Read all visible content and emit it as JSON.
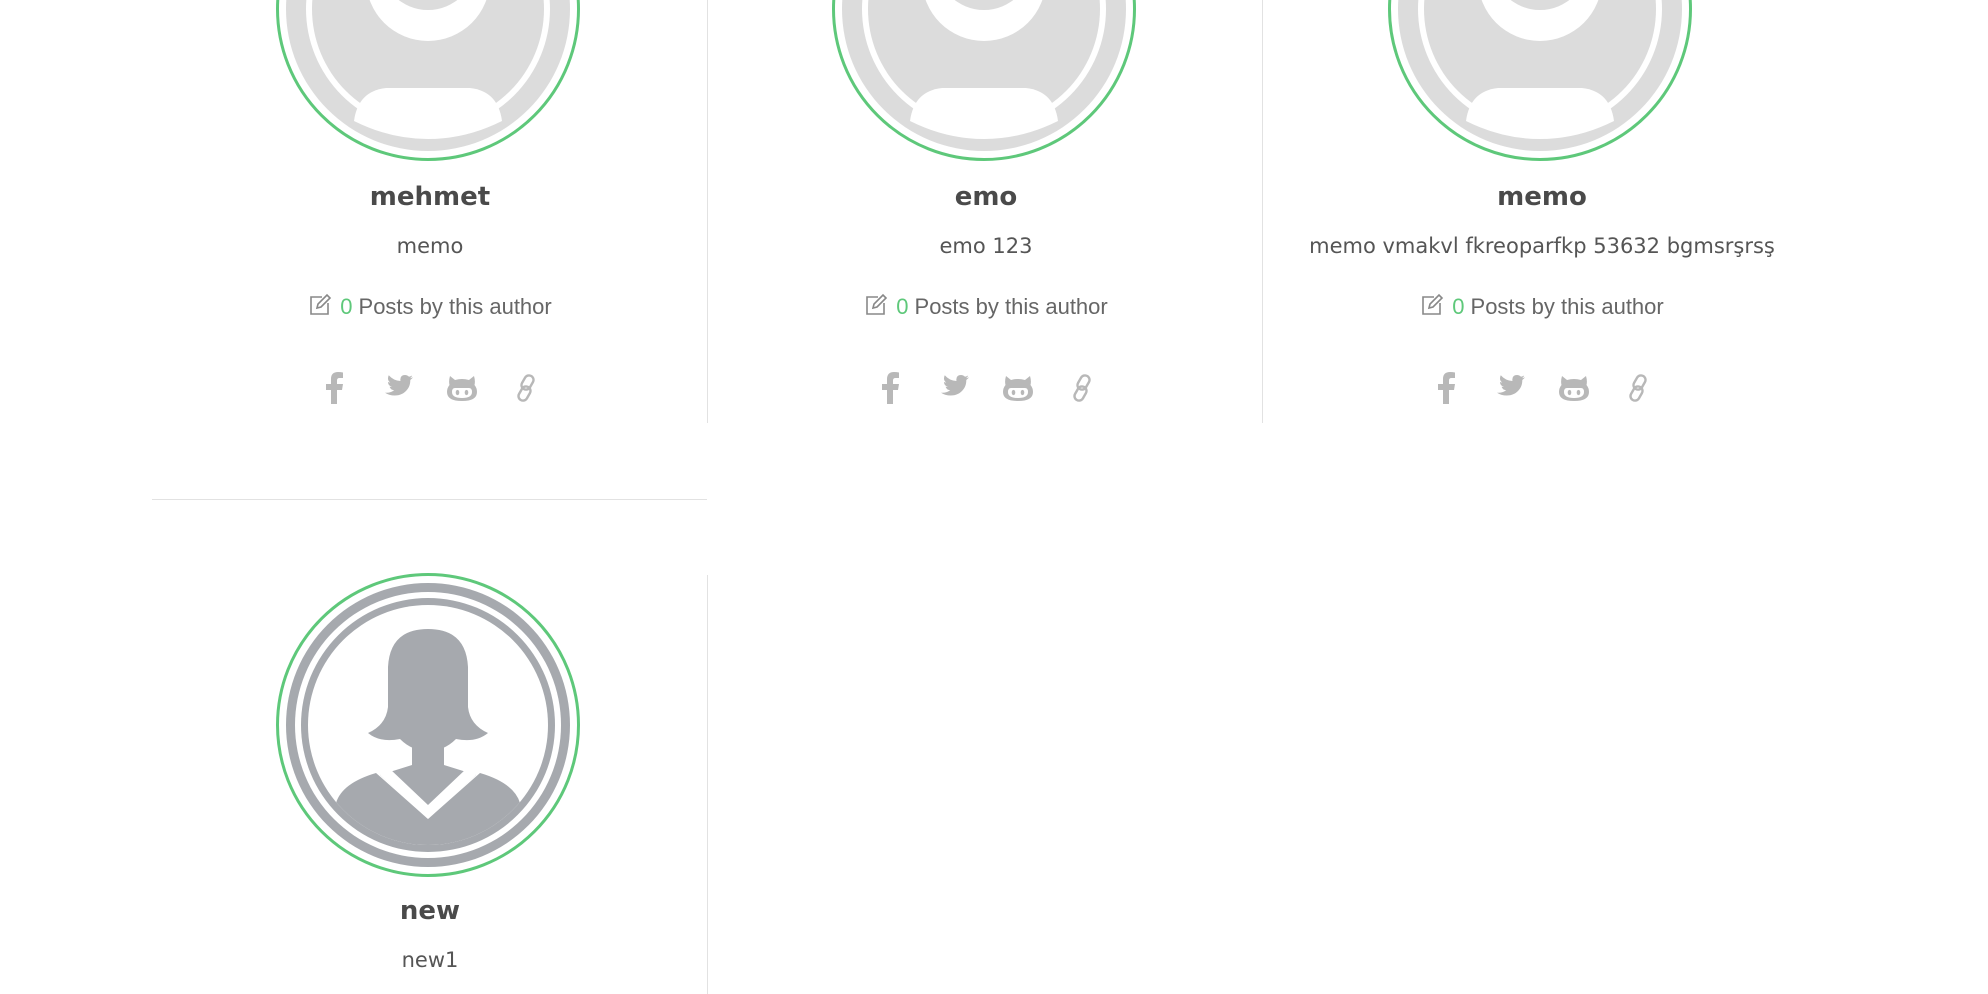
{
  "authors": [
    {
      "name": "mehmet",
      "bio": "memo",
      "post_count": "0",
      "posts_label": "Posts by this author",
      "avatar": "default-avatar"
    },
    {
      "name": "emo",
      "bio": "emo 123",
      "post_count": "0",
      "posts_label": "Posts by this author",
      "avatar": "default-avatar"
    },
    {
      "name": "memo",
      "bio": "memo vmakvl fkreoparfkp 53632 bgmsrşrsş",
      "post_count": "0",
      "posts_label": "Posts by this author",
      "avatar": "default-avatar"
    },
    {
      "name": "new",
      "bio": "new1",
      "avatar": "female-avatar"
    }
  ],
  "social_icons": [
    "facebook-icon",
    "twitter-icon",
    "github-icon",
    "link-icon"
  ],
  "colors": {
    "accent": "#5ec87a",
    "avatar_light": "#dcdcdc",
    "avatar_dark": "#a6a9ae",
    "icon_gray": "#b8b8b8",
    "divider": "#e2e2e2"
  }
}
